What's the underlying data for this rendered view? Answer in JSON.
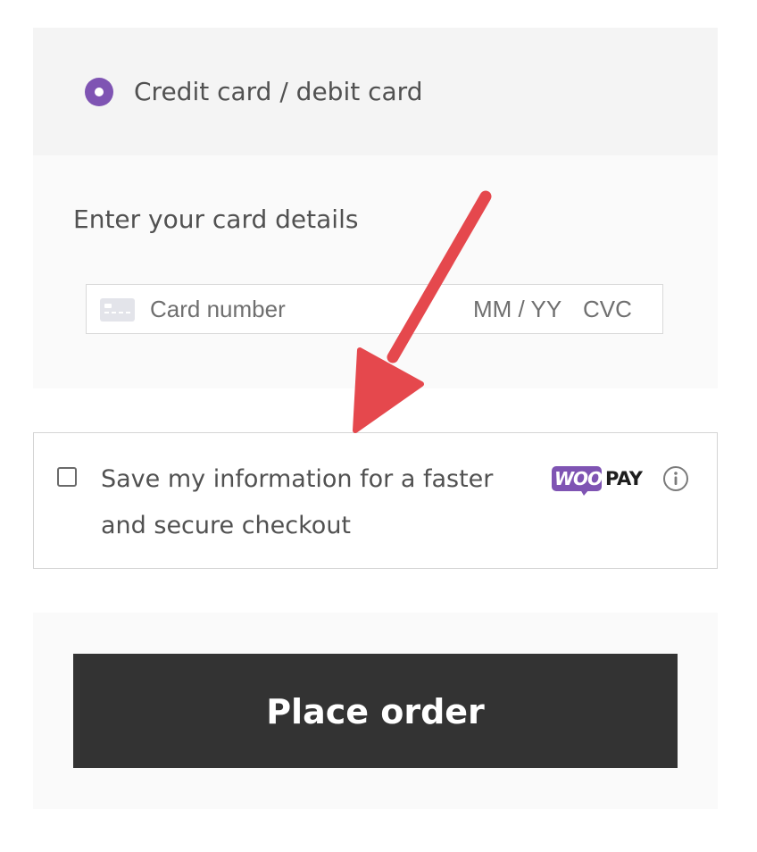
{
  "payment_method": {
    "label": "Credit card / debit card",
    "selected": true,
    "accent_color": "#7f54b3"
  },
  "card_details": {
    "heading": "Enter your card details",
    "card_icon": "credit-card-icon",
    "card_number_placeholder": "Card number",
    "expiry_placeholder": "MM / YY",
    "cvc_placeholder": "CVC"
  },
  "woopay": {
    "checkbox_checked": false,
    "label": "Save my information for a faster and secure checkout",
    "logo_woo": "WOO",
    "logo_pay": "PAY",
    "info_icon": "info-circle-icon",
    "logo_color": "#7f54b3"
  },
  "order": {
    "button_label": "Place order",
    "button_color": "#333333"
  },
  "annotation": {
    "arrow_color": "#e5484d"
  }
}
